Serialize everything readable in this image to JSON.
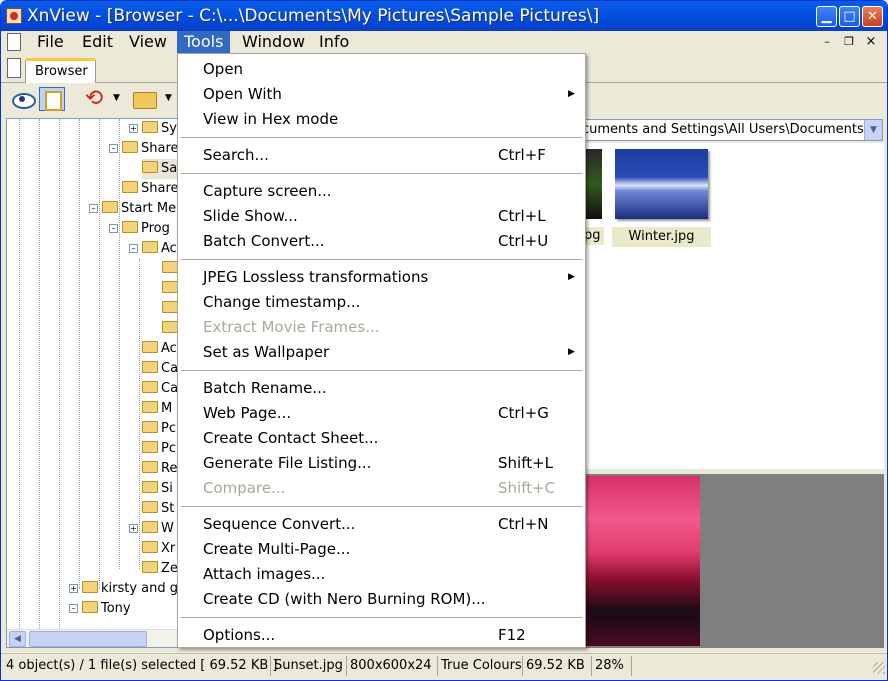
{
  "window": {
    "title": "XnView - [Browser - C:\\...\\Documents\\My Pictures\\Sample Pictures\\]",
    "accent_color": "#0054e3",
    "highlight_color": "#316ac5"
  },
  "menubar": {
    "items": [
      "File",
      "Edit",
      "View",
      "Tools",
      "Window",
      "Info"
    ],
    "active": "Tools"
  },
  "tabs": {
    "browser_label": "Browser"
  },
  "toolbar": {
    "icons": [
      "eye-icon",
      "fullscreen-icon",
      "refresh-icon",
      "folder-icon"
    ]
  },
  "tree": {
    "items": [
      {
        "label": "Sy",
        "icon": "folder-icon"
      },
      {
        "label": "Share",
        "icon": "folder-icon"
      },
      {
        "label": "Sa",
        "icon": "folder-icon"
      },
      {
        "label": "Share",
        "icon": "folder-icon"
      },
      {
        "label": "Start Me",
        "icon": "folder-icon"
      },
      {
        "label": "Prog",
        "icon": "folder-icon"
      },
      {
        "label": "Ac",
        "icon": "folder-icon"
      },
      {
        "label": "",
        "icon": "folder-icon"
      },
      {
        "label": "",
        "icon": "folder-icon"
      },
      {
        "label": "",
        "icon": "folder-icon"
      },
      {
        "label": "",
        "icon": "folder-icon"
      },
      {
        "label": "Ac",
        "icon": "folder-icon"
      },
      {
        "label": "Ca",
        "icon": "folder-icon"
      },
      {
        "label": "Ca",
        "icon": "folder-icon"
      },
      {
        "label": "M",
        "icon": "folder-icon"
      },
      {
        "label": "Pc",
        "icon": "folder-icon"
      },
      {
        "label": "Pc",
        "icon": "folder-icon"
      },
      {
        "label": "Re",
        "icon": "folder-icon"
      },
      {
        "label": "Si",
        "icon": "folder-icon"
      },
      {
        "label": "St",
        "icon": "folder-icon"
      },
      {
        "label": "W",
        "icon": "folder-icon"
      },
      {
        "label": "Xr",
        "icon": "folder-icon"
      },
      {
        "label": "Ze",
        "icon": "folder-icon"
      },
      {
        "label": "kirsty and g",
        "icon": "folder-icon"
      },
      {
        "label": "Tony",
        "icon": "folder-icon"
      }
    ]
  },
  "path_combo": {
    "value": "cuments and Settings\\All Users\\Documents\\I"
  },
  "thumbnails": {
    "partial_label": "pg",
    "winter_label": "Winter.jpg"
  },
  "tools_menu": {
    "items": [
      {
        "label": "Open",
        "shortcut": "",
        "submenu": false,
        "disabled": false
      },
      {
        "label": "Open With",
        "shortcut": "",
        "submenu": true,
        "disabled": false
      },
      {
        "label": "View in Hex mode",
        "shortcut": "",
        "submenu": false,
        "disabled": false
      },
      {
        "label": "Search...",
        "shortcut": "Ctrl+F",
        "submenu": false,
        "disabled": false
      },
      {
        "label": "Capture screen...",
        "shortcut": "",
        "submenu": false,
        "disabled": false
      },
      {
        "label": "Slide Show...",
        "shortcut": "Ctrl+L",
        "submenu": false,
        "disabled": false
      },
      {
        "label": "Batch Convert...",
        "shortcut": "Ctrl+U",
        "submenu": false,
        "disabled": false
      },
      {
        "label": "JPEG Lossless transformations",
        "shortcut": "",
        "submenu": true,
        "disabled": false
      },
      {
        "label": "Change timestamp...",
        "shortcut": "",
        "submenu": false,
        "disabled": false
      },
      {
        "label": "Extract Movie Frames...",
        "shortcut": "",
        "submenu": false,
        "disabled": true
      },
      {
        "label": "Set as Wallpaper",
        "shortcut": "",
        "submenu": true,
        "disabled": false
      },
      {
        "label": "Batch Rename...",
        "shortcut": "",
        "submenu": false,
        "disabled": false
      },
      {
        "label": "Web Page...",
        "shortcut": "Ctrl+G",
        "submenu": false,
        "disabled": false
      },
      {
        "label": "Create Contact Sheet...",
        "shortcut": "",
        "submenu": false,
        "disabled": false
      },
      {
        "label": "Generate File Listing...",
        "shortcut": "Shift+L",
        "submenu": false,
        "disabled": false
      },
      {
        "label": "Compare...",
        "shortcut": "Shift+C",
        "submenu": false,
        "disabled": true
      },
      {
        "label": "Sequence Convert...",
        "shortcut": "Ctrl+N",
        "submenu": false,
        "disabled": false
      },
      {
        "label": "Create Multi-Page...",
        "shortcut": "",
        "submenu": false,
        "disabled": false
      },
      {
        "label": "Attach images...",
        "shortcut": "",
        "submenu": false,
        "disabled": false
      },
      {
        "label": "Create CD (with Nero Burning ROM)...",
        "shortcut": "",
        "submenu": false,
        "disabled": false
      },
      {
        "label": "Options...",
        "shortcut": "F12",
        "submenu": false,
        "disabled": false
      }
    ]
  },
  "statusbar": {
    "objects": "4 object(s) / 1 file(s) selected  [ 69.52 KB ]",
    "file": "Sunset.jpg",
    "dims": "800x600x24",
    "colours": "True Colours",
    "size": "69.52 KB",
    "zoom": "28%"
  }
}
